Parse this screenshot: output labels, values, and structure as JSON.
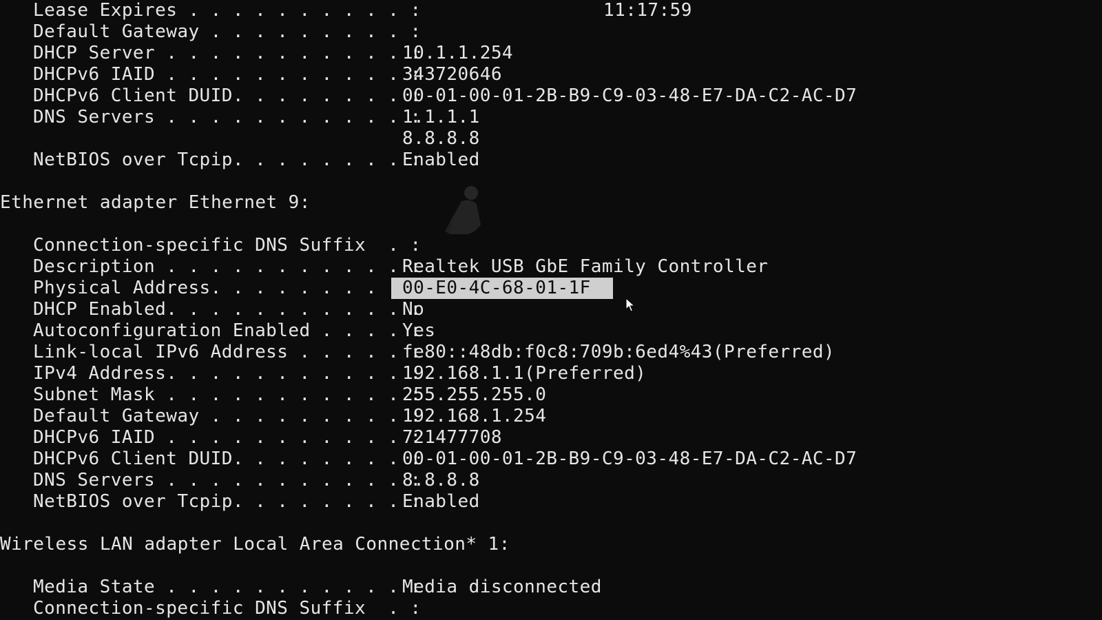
{
  "top_section": {
    "rows": [
      {
        "label": "Lease Expires . . . . . . . . . . :",
        "value": "11:17:59"
      },
      {
        "label": "Default Gateway . . . . . . . . . :",
        "value": ""
      },
      {
        "label": "DHCP Server . . . . . . . . . . . :",
        "value": "10.1.1.254"
      },
      {
        "label": "DHCPv6 IAID . . . . . . . . . . . :",
        "value": "343720646"
      },
      {
        "label": "DHCPv6 Client DUID. . . . . . . . :",
        "value": "00-01-00-01-2B-B9-C9-03-48-E7-DA-C2-AC-D7"
      },
      {
        "label": "DNS Servers . . . . . . . . . . . :",
        "value": "1.1.1.1"
      },
      {
        "label": "",
        "value": "8.8.8.8"
      },
      {
        "label": "NetBIOS over Tcpip. . . . . . . . :",
        "value": "Enabled"
      }
    ]
  },
  "ethernet9": {
    "header": "Ethernet adapter Ethernet 9:",
    "rows": [
      {
        "label": "Connection-specific DNS Suffix  . :",
        "value": ""
      },
      {
        "label": "Description . . . . . . . . . . . :",
        "value": "Realtek USB GbE Family Controller"
      },
      {
        "label": "Physical Address. . . . . . . . . :",
        "value": "00-E0-4C-68-01-1F"
      },
      {
        "label": "DHCP Enabled. . . . . . . . . . . :",
        "value": "No"
      },
      {
        "label": "Autoconfiguration Enabled . . . . :",
        "value": "Yes"
      },
      {
        "label": "Link-local IPv6 Address . . . . . :",
        "value": "fe80::48db:f0c8:709b:6ed4%43(Preferred)"
      },
      {
        "label": "IPv4 Address. . . . . . . . . . . :",
        "value": "192.168.1.1(Preferred)"
      },
      {
        "label": "Subnet Mask . . . . . . . . . . . :",
        "value": "255.255.255.0"
      },
      {
        "label": "Default Gateway . . . . . . . . . :",
        "value": "192.168.1.254"
      },
      {
        "label": "DHCPv6 IAID . . . . . . . . . . . :",
        "value": "721477708"
      },
      {
        "label": "DHCPv6 Client DUID. . . . . . . . :",
        "value": "00-01-00-01-2B-B9-C9-03-48-E7-DA-C2-AC-D7"
      },
      {
        "label": "DNS Servers . . . . . . . . . . . :",
        "value": "8.8.8.8"
      },
      {
        "label": "NetBIOS over Tcpip. . . . . . . . :",
        "value": "Enabled"
      }
    ]
  },
  "wireless": {
    "header": "Wireless LAN adapter Local Area Connection* 1:",
    "rows": [
      {
        "label": "Media State . . . . . . . . . . . :",
        "value": "Media disconnected"
      },
      {
        "label": "Connection-specific DNS Suffix  . :",
        "value": ""
      }
    ]
  },
  "colors": {
    "background": "#0c0c0c",
    "text": "#e6e6e6",
    "selection": "#cfcfcf"
  },
  "icons": {
    "cursor": "mouse-pointer-icon",
    "watermark": "figure-watermark-icon"
  }
}
